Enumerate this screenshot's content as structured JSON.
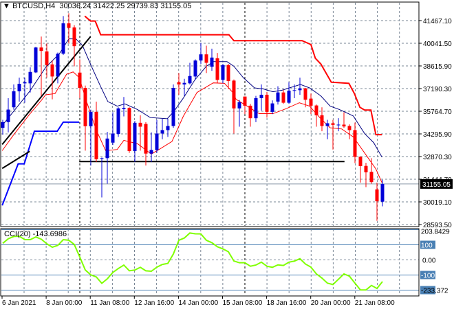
{
  "header": {
    "symbol": "BTCUSD,H4",
    "open": "30036.24",
    "high": "31422.25",
    "low": "29739.83",
    "close": "31155.05"
  },
  "colors": {
    "bull": "#0000d8",
    "bear": "#ff0000",
    "ma_fast": "#ff0000",
    "ma_slow": "#000080",
    "channel_upper": "#ff0000",
    "channel_lower": "#0000ff",
    "cci": "#80ff00",
    "level": "#4a80b4",
    "grid": "#7a8796"
  },
  "chart_data": [
    {
      "type": "candlestick",
      "title": "BTCUSD,H4",
      "ylim": [
        28593.5,
        41467.1
      ],
      "y_ticks": [
        "41467.10",
        "40041.50",
        "38615.90",
        "37190.30",
        "35764.70",
        "34295.90",
        "32870.30",
        "31444.70",
        "30019.10",
        "28593.50"
      ],
      "current_price_label": "31155.05",
      "current_price": 31155.05,
      "x_labels": [
        "6 Jan 2021",
        "8 Jan 00:00",
        "11 Jan 08:00",
        "12 Jan 16:00",
        "14 Jan 00:00",
        "15 Jan 08:00",
        "18 Jan 16:00",
        "20 Jan 00:00",
        "21 Jan 08:00"
      ],
      "ohlc": [
        [
          34699,
          35203,
          34267,
          35059
        ],
        [
          35059,
          36571,
          34411,
          35851
        ],
        [
          35995,
          37435,
          35851,
          37003
        ],
        [
          37003,
          37867,
          36355,
          37478
        ],
        [
          37507,
          37867,
          36283,
          37579
        ],
        [
          37507,
          38515,
          36931,
          38227
        ],
        [
          38198,
          39811,
          38155,
          39768
        ],
        [
          39768,
          40459,
          36715,
          39552
        ],
        [
          39523,
          40027,
          37867,
          38659
        ],
        [
          38702,
          38947,
          36499,
          37939
        ],
        [
          37939,
          39451,
          37507,
          39379
        ],
        [
          39379,
          41755,
          39307,
          41294
        ],
        [
          41294,
          41928,
          40027,
          41006
        ],
        [
          41035,
          41179,
          38587,
          39854
        ],
        [
          38184,
          39019,
          36571,
          37219
        ],
        [
          37219,
          37363,
          33259,
          34800
        ],
        [
          34800,
          35851,
          32323,
          35707
        ],
        [
          35707,
          36355,
          32539,
          32712
        ],
        [
          32755,
          32827,
          30307,
          32784
        ],
        [
          32784,
          34440,
          31171,
          34022
        ],
        [
          33763,
          35678,
          33619,
          34339
        ],
        [
          34310,
          35995,
          34123,
          35923
        ],
        [
          35880,
          36643,
          35419,
          35952
        ],
        [
          35952,
          35995,
          33115,
          33230
        ],
        [
          33230,
          35131,
          32539,
          35016
        ],
        [
          35016,
          35491,
          33259,
          34771
        ],
        [
          34944,
          35059,
          32323,
          33072
        ],
        [
          33072,
          34411,
          32539,
          33302
        ],
        [
          33288,
          35203,
          33115,
          34339
        ],
        [
          34339,
          35275,
          33979,
          34555
        ],
        [
          34555,
          35275,
          34123,
          34814
        ],
        [
          34814,
          37435,
          34699,
          37219
        ],
        [
          37579,
          38155,
          36787,
          37435
        ],
        [
          37435,
          37795,
          36715,
          37536
        ],
        [
          37507,
          38803,
          37435,
          37968
        ],
        [
          37939,
          39019,
          37723,
          38947
        ],
        [
          38947,
          40056,
          38731,
          39336
        ],
        [
          39336,
          39883,
          38155,
          38803
        ],
        [
          38558,
          39696,
          38299,
          39134
        ],
        [
          39091,
          39422,
          37507,
          37723
        ],
        [
          37723,
          38731,
          37507,
          38659
        ],
        [
          38659,
          38731,
          37147,
          37651
        ],
        [
          37680,
          37752,
          34339,
          35923
        ],
        [
          35923,
          36456,
          34771,
          36312
        ],
        [
          36672,
          36672,
          35563,
          36096
        ],
        [
          36096,
          36211,
          34771,
          35304
        ],
        [
          35304,
          36715,
          35059,
          36571
        ],
        [
          36571,
          37435,
          35779,
          36787
        ],
        [
          36787,
          36960,
          35347,
          35707
        ],
        [
          35707,
          36427,
          35563,
          36240
        ],
        [
          36355,
          37320,
          36168,
          36931
        ],
        [
          36931,
          37104,
          36211,
          36283
        ],
        [
          36283,
          37579,
          36211,
          37046
        ],
        [
          37032,
          37435,
          36571,
          37075
        ],
        [
          37075,
          37867,
          36787,
          37190
        ],
        [
          37190,
          37219,
          35995,
          36470
        ],
        [
          36542,
          36859,
          35563,
          36096
        ],
        [
          36110,
          36168,
          34771,
          35491
        ],
        [
          35491,
          35995,
          34483,
          34814
        ],
        [
          34814,
          35203,
          33979,
          34987
        ],
        [
          34987,
          35203,
          33331,
          34886
        ],
        [
          34872,
          35304,
          34483,
          34901
        ],
        [
          34901,
          35678,
          34699,
          34785
        ],
        [
          34814,
          34915,
          33979,
          34555
        ],
        [
          34555,
          35030,
          32467,
          32870
        ],
        [
          32870,
          32899,
          31243,
          32280
        ],
        [
          32294,
          32496,
          30955,
          31891
        ],
        [
          31920,
          32784,
          31171,
          31272
        ],
        [
          30811,
          31243,
          28824,
          30062
        ],
        [
          30036.24,
          31422.25,
          29739.83,
          31155.05
        ]
      ],
      "ma_slow": [
        [
          0.9,
          34843
        ],
        [
          5.9,
          37003
        ],
        [
          8.8,
          38515
        ],
        [
          11.3,
          39379
        ],
        [
          13,
          40315
        ],
        [
          14.3,
          40315
        ],
        [
          15.5,
          39883
        ],
        [
          17.2,
          38515
        ],
        [
          18.8,
          37291
        ],
        [
          20.1,
          36355
        ],
        [
          21.8,
          36067
        ],
        [
          23.2,
          36211
        ],
        [
          25.5,
          35851
        ],
        [
          27.8,
          35347
        ],
        [
          30.9,
          35275
        ],
        [
          32.2,
          35779
        ],
        [
          33.8,
          36571
        ],
        [
          35.9,
          37723
        ],
        [
          38,
          38587
        ],
        [
          39.3,
          38875
        ],
        [
          41.75,
          38875
        ],
        [
          43,
          38587
        ],
        [
          44.7,
          37867
        ],
        [
          46.75,
          37219
        ],
        [
          48.4,
          37147
        ],
        [
          50.1,
          36974
        ],
        [
          51.75,
          37075
        ],
        [
          55.1,
          37435
        ],
        [
          56.75,
          37219
        ],
        [
          58.8,
          36715
        ],
        [
          60.5,
          36067
        ],
        [
          62.2,
          35851
        ],
        [
          64.7,
          35448
        ],
        [
          66.75,
          34339
        ],
        [
          68.4,
          33763
        ],
        [
          69.9,
          32856
        ]
      ],
      "ma_fast": [
        [
          0.9,
          33259
        ],
        [
          3,
          34267
        ],
        [
          5.9,
          35563
        ],
        [
          8,
          36427
        ],
        [
          8.8,
          36787
        ],
        [
          10.5,
          36859
        ],
        [
          12.6,
          38083
        ],
        [
          13.8,
          38227
        ],
        [
          14.9,
          37867
        ],
        [
          16.3,
          36283
        ],
        [
          18,
          34555
        ],
        [
          19.7,
          33259
        ],
        [
          21.8,
          33331
        ],
        [
          23,
          33907
        ],
        [
          25.5,
          33691
        ],
        [
          28,
          33043
        ],
        [
          29.4,
          33331
        ],
        [
          31.75,
          33835
        ],
        [
          33.8,
          35419
        ],
        [
          36.3,
          36931
        ],
        [
          39.25,
          37536
        ],
        [
          41.3,
          37507
        ],
        [
          42.8,
          36931
        ],
        [
          43.4,
          36499
        ],
        [
          45.1,
          36139
        ],
        [
          47.6,
          35592
        ],
        [
          50.1,
          35592
        ],
        [
          52.6,
          35923
        ],
        [
          54.9,
          36283
        ],
        [
          56.75,
          36067
        ],
        [
          58.8,
          35275
        ],
        [
          60.5,
          34699
        ],
        [
          62.6,
          34627
        ],
        [
          64.7,
          34123
        ],
        [
          66.75,
          33115
        ],
        [
          68.8,
          32107
        ],
        [
          69.9,
          31243
        ]
      ],
      "channel_upper": [
        [
          15.9,
          41755
        ],
        [
          16.96,
          41438
        ],
        [
          17.8,
          41438
        ],
        [
          18.8,
          40574
        ],
        [
          42.1,
          40574
        ],
        [
          43,
          40200
        ],
        [
          55.4,
          40200
        ],
        [
          57,
          39955
        ],
        [
          57.8,
          39091
        ],
        [
          58.8,
          38731
        ],
        [
          60.7,
          37579
        ],
        [
          63.9,
          37507
        ],
        [
          64.9,
          36859
        ],
        [
          65.9,
          35995
        ],
        [
          66.75,
          35822
        ],
        [
          67.9,
          35822
        ],
        [
          68.8,
          34267
        ],
        [
          69.9,
          34267
        ]
      ],
      "channel_lower": [
        [
          0.9,
          29803
        ],
        [
          3.8,
          32424
        ],
        [
          4.9,
          32424
        ],
        [
          6.75,
          34483
        ],
        [
          10.9,
          34483
        ],
        [
          12,
          35059
        ],
        [
          14.9,
          35059
        ]
      ],
      "trendlines": [
        [
          [
            0.9,
            33648
          ],
          [
            16.96,
            40459
          ]
        ],
        [
          [
            0.9,
            32136
          ],
          [
            5.9,
            33216
          ]
        ],
        [
          [
            14.9,
            32568
          ],
          [
            63.1,
            32568
          ]
        ]
      ]
    },
    {
      "type": "line",
      "title": "CCI(20)",
      "current_value_label": "-143.6986",
      "ylim": [
        -233.372,
        203.8429
      ],
      "max_label": "203.8429",
      "min_label": "-233.372",
      "levels": [
        200,
        100,
        -100,
        -200
      ],
      "level_labels": [
        "100",
        "0.00",
        "-100"
      ],
      "values": [
        110,
        140,
        155,
        157,
        134,
        134,
        152,
        137,
        107,
        84,
        96,
        134,
        130,
        102,
        19,
        -67,
        -99,
        -113,
        -155,
        -125,
        -83,
        -57,
        -34,
        -72,
        -67,
        -49,
        -72,
        -75,
        -48,
        -30,
        -23,
        39,
        130,
        145,
        178,
        173,
        172,
        130,
        114,
        87,
        73,
        54,
        -7,
        -19,
        -19,
        -42,
        -34,
        -15,
        -42,
        -49,
        -33,
        -37,
        -15,
        -8,
        8,
        -27,
        -48,
        -93,
        -120,
        -154,
        -163,
        -128,
        -93,
        -108,
        -154,
        -199,
        -199,
        -169,
        -189,
        -143.7
      ]
    }
  ]
}
